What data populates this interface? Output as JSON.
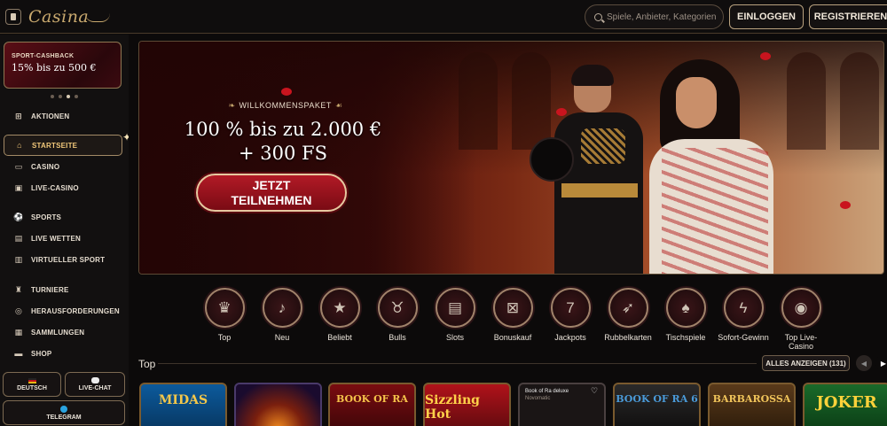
{
  "header": {
    "logo_text": "Casina",
    "search_placeholder": "Spiele, Anbieter, Kategorien",
    "login_label": "EINLOGGEN",
    "register_label": "REGISTRIEREN"
  },
  "sidebar": {
    "promo": {
      "subtitle": "SPORT-CASHBACK",
      "title": "15% bis zu 500 €"
    },
    "nav_groups": [
      [
        {
          "label": "AKTIONEN",
          "icon": "gift-icon"
        }
      ],
      [
        {
          "label": "STARTSEITE",
          "icon": "home-icon",
          "active": true
        },
        {
          "label": "CASINO",
          "icon": "cards-icon"
        },
        {
          "label": "LIVE-CASINO",
          "icon": "live-icon"
        }
      ],
      [
        {
          "label": "SPORTS",
          "icon": "ball-icon"
        },
        {
          "label": "LIVE WETTEN",
          "icon": "live-bet-icon"
        },
        {
          "label": "VIRTUELLER SPORT",
          "icon": "monitor-icon"
        }
      ],
      [
        {
          "label": "TURNIERE",
          "icon": "trophy-icon"
        },
        {
          "label": "HERAUSFORDERUNGEN",
          "icon": "target-icon"
        },
        {
          "label": "SAMMLUNGEN",
          "icon": "collection-icon"
        },
        {
          "label": "SHOP",
          "icon": "shop-icon"
        }
      ]
    ],
    "language_label": "DEUTSCH",
    "chat_label": "LIVE-CHAT",
    "telegram_label": "TELEGRAM"
  },
  "hero": {
    "kicker": "WILLKOMMENSPAKET",
    "title_line1": "100 % bis zu 2.000 €",
    "title_line2": "+ 300 FS",
    "cta_line1": "JETZT",
    "cta_line2": "TEILNEHMEN"
  },
  "categories": [
    {
      "label": "Top",
      "icon": "crown-icon",
      "glyph": "♛"
    },
    {
      "label": "Neu",
      "icon": "bell-icon",
      "glyph": "🔔"
    },
    {
      "label": "Beliebt",
      "icon": "star-icon",
      "glyph": "★"
    },
    {
      "label": "Bulls",
      "icon": "bull-icon",
      "glyph": "♉"
    },
    {
      "label": "Slots",
      "icon": "slot-machine-icon",
      "glyph": "▤"
    },
    {
      "label": "Bonuskauf",
      "icon": "gift-box-icon",
      "glyph": "🎁"
    },
    {
      "label": "Jackpots",
      "icon": "seven-icon",
      "glyph": "7"
    },
    {
      "label": "Rubbelkarten",
      "icon": "rocket-icon",
      "glyph": "➶"
    },
    {
      "label": "Tischspiele",
      "icon": "playing-cards-icon",
      "glyph": "♠"
    },
    {
      "label": "Sofort-Gewinn",
      "icon": "lightning-icon",
      "glyph": "⚡"
    },
    {
      "label": "Top Live-Casino",
      "icon": "chip-icon",
      "glyph": "◉"
    }
  ],
  "top_section": {
    "title": "Top",
    "show_all_label": "ALLES ANZEIGEN (131)"
  },
  "games": [
    {
      "name": "MIDAS",
      "tag": "GOLDEN TOUCH"
    },
    {
      "name": "",
      "tag": ""
    },
    {
      "name": "BOOK OF RA",
      "tag": "MAGIC"
    },
    {
      "name": "Sizzling Hot",
      "tag": "deluxe"
    },
    {
      "name": "Book of Ra deluxe",
      "tag": "Novomatic"
    },
    {
      "name": "BOOK OF RA 6",
      "tag": ""
    },
    {
      "name": "BARBAROSSA",
      "tag": ""
    },
    {
      "name": "JOKER",
      "tag": ""
    }
  ],
  "colors": {
    "accent_gold": "#c9a96e",
    "cta_red": "#b21a26",
    "background": "#0c0a0a"
  }
}
